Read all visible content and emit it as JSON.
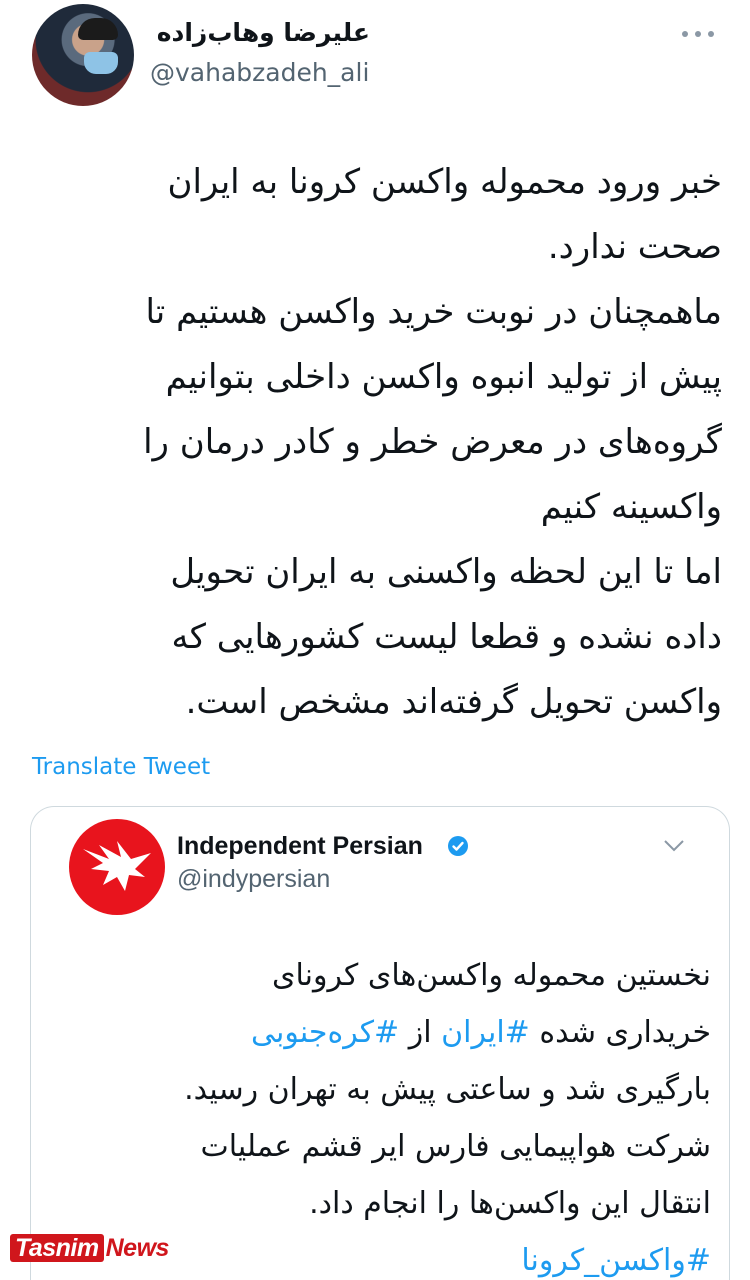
{
  "author": {
    "display_name": "علیرضا وهاب‌زاده",
    "handle": "@vahabzadeh_ali"
  },
  "tweet": {
    "text": "خبر ورود محموله واکسن کرونا به ایران\nصحت ندارد.\nماهمچنان در نوبت خرید واکسن هستیم تا\nپیش از تولید انبوه واکسن داخلی بتوانیم\nگروه‌های در معرض خطر و کادر درمان را\nواکسینه کنیم\nاما تا این لحظه واکسنی به ایران تحویل\nداده نشده و قطعا لیست کشورهایی که\nواکسن تحویل گرفته‌اند مشخص است."
  },
  "translate_label": "Translate Tweet",
  "quoted": {
    "name": "Independent Persian",
    "handle": "@indypersian",
    "lines": [
      {
        "parts": [
          {
            "text": "نخستین محموله واکسن‌های کرونای",
            "hashtag": false
          }
        ]
      },
      {
        "parts": [
          {
            "text": "خریداری شده ",
            "hashtag": false
          },
          {
            "text": "#ایران",
            "hashtag": true
          },
          {
            "text": " از ",
            "hashtag": false
          },
          {
            "text": "#کره‌جنوبی",
            "hashtag": true
          }
        ]
      },
      {
        "parts": [
          {
            "text": "بارگیری شد و ساعتی پیش به تهران رسید.",
            "hashtag": false
          }
        ]
      },
      {
        "parts": [
          {
            "text": "شرکت هواپیمایی فارس ایر قشم عملیات",
            "hashtag": false
          }
        ]
      },
      {
        "parts": [
          {
            "text": "انتقال این واکسن‌ها را انجام داد.",
            "hashtag": false
          }
        ]
      },
      {
        "parts": [
          {
            "text": "#واکسن_کرونا",
            "hashtag": true
          }
        ]
      }
    ]
  },
  "watermark": {
    "part1": "Tasnim",
    "part2": "News"
  },
  "icons": {
    "more": "more-horizontal-icon",
    "verified": "verified-badge-icon",
    "chevron": "chevron-down-icon",
    "logo": "eagle-logo-icon"
  },
  "colors": {
    "link": "#1d9bf0",
    "secondary_text": "#536471",
    "brand_red": "#e8141d"
  }
}
